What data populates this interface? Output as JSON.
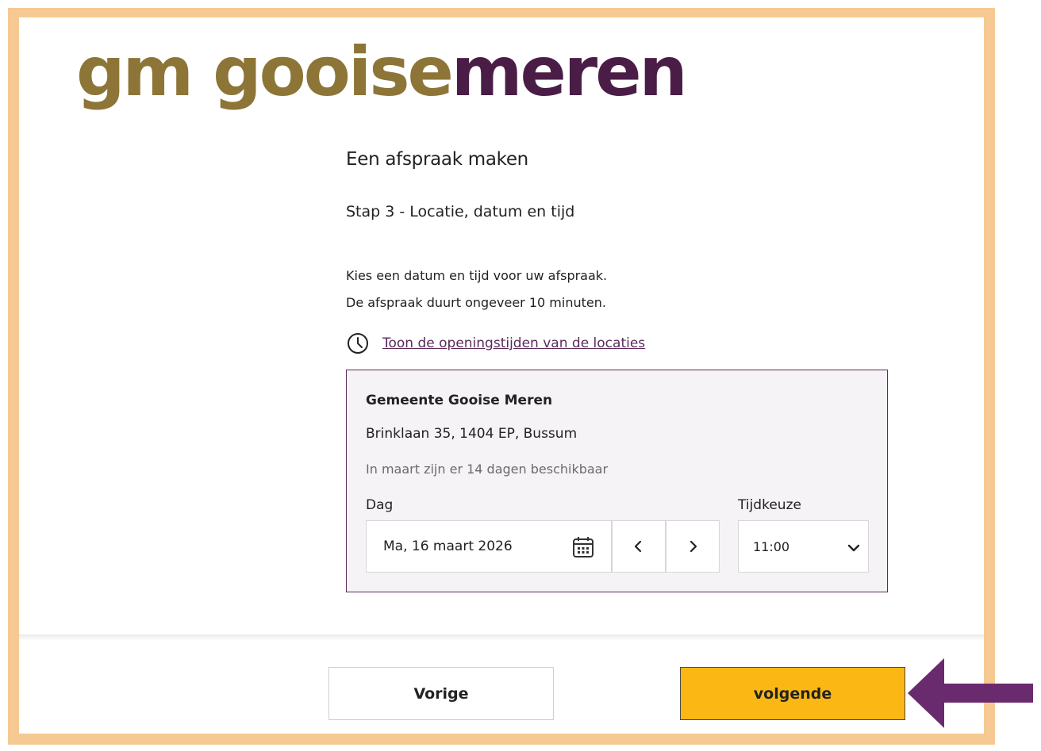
{
  "logo": {
    "mark": "gm",
    "word_a": "gooise",
    "word_b": "meren",
    "color_a": "#8c7537",
    "color_b": "#4a1d47"
  },
  "page": {
    "title": "Een afspraak maken",
    "step": "Stap 3 - Locatie, datum en tijd",
    "intro_line1": "Kies een datum en tijd voor uw afspraak.",
    "intro_line2": "De afspraak duurt ongeveer 10 minuten.",
    "hours_link": "Toon de openingstijden van de locaties",
    "hours_icon": "clock-icon"
  },
  "location": {
    "name": "Gemeente Gooise Meren",
    "address": "Brinklaan 35, 1404 EP, Bussum",
    "availability": "In maart zijn er 14 dagen beschikbaar",
    "day_label": "Dag",
    "date_value": "Ma, 16 maart 2026",
    "time_label": "Tijdkeuze",
    "time_value": "11:00"
  },
  "footer": {
    "prev_label": "Vorige",
    "next_label": "volgende"
  },
  "colors": {
    "frame": "#f6c992",
    "accent_purple": "#5b2d57",
    "next_button": "#fbb814",
    "arrow": "#6a2a6e"
  },
  "icons": [
    "clock-icon",
    "calendar-icon",
    "chevron-left-icon",
    "chevron-right-icon",
    "chevron-down-icon",
    "pointer-arrow-icon"
  ]
}
